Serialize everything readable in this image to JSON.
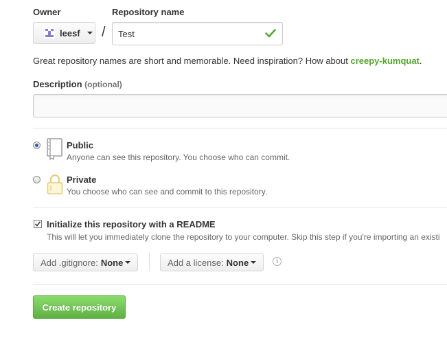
{
  "owner": {
    "label": "Owner",
    "username": "leesf"
  },
  "separator": "/",
  "repo_name": {
    "label": "Repository name",
    "value": "Test",
    "valid": true
  },
  "hint": {
    "text": "Great repository names are short and memorable. Need inspiration? How about ",
    "suggestion": "creepy-kumquat",
    "end": "."
  },
  "description": {
    "label": "Description",
    "optional": "(optional)",
    "value": ""
  },
  "visibility": {
    "selected": "public",
    "options": [
      {
        "title": "Public",
        "subtitle": "Anyone can see this repository. You choose who can commit.",
        "icon": "repo-book-icon"
      },
      {
        "title": "Private",
        "subtitle": "You choose who can see and commit to this repository.",
        "icon": "lock-icon"
      }
    ]
  },
  "readme": {
    "checked": true,
    "title": "Initialize this repository with a README",
    "subtitle": "This will let you immediately clone the repository to your computer. Skip this step if you're importing an existi"
  },
  "gitignore": {
    "label": "Add .gitignore:",
    "value": "None"
  },
  "license": {
    "label": "Add a license:",
    "value": "None"
  },
  "info_icon": "i",
  "create_button": "Create repository",
  "colors": {
    "success": "#55a532",
    "primary_button": "#60b044",
    "radio_dot": "#2e5fa8"
  }
}
